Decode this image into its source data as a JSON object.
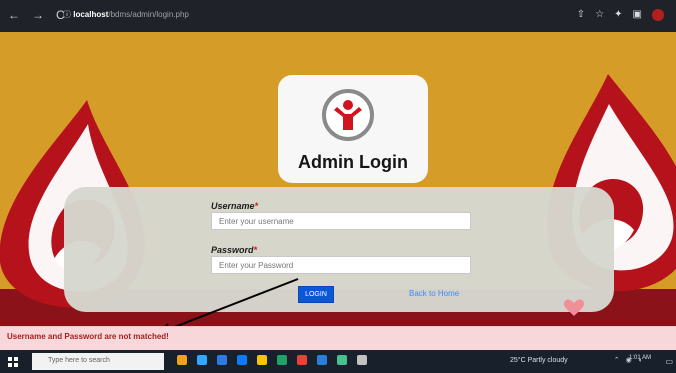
{
  "browser": {
    "url_host": "localhost",
    "url_path": "/bdms/admin/login.php"
  },
  "login": {
    "title": "Admin Login",
    "username_label": "Username",
    "username_placeholder": "Enter your username",
    "password_label": "Password",
    "password_placeholder": "Enter your Password",
    "required_mark": "*",
    "login_button": "LOGIN",
    "back_link": "Back to Home"
  },
  "error": {
    "message": "Username and Password are not matched!"
  },
  "taskbar": {
    "search_placeholder": "Type here to search",
    "weather": "25°C  Partly cloudy",
    "time": "1:01 AM"
  },
  "colors": {
    "background": "#d59d28",
    "error_text": "#a61f1f",
    "button": "#0b57d8"
  }
}
